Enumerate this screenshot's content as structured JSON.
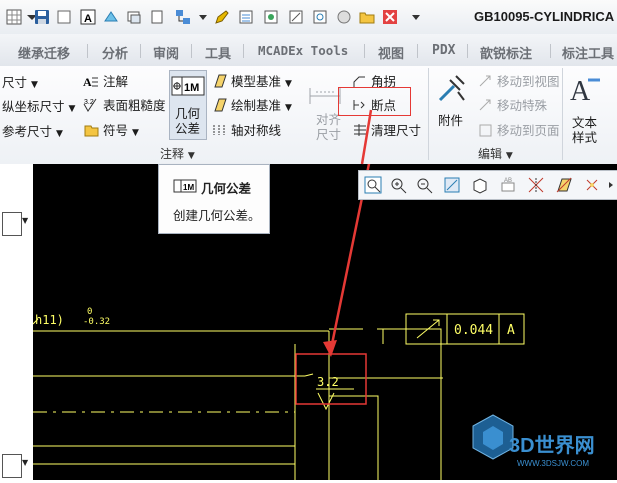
{
  "window": {
    "title": "GB10095-CYLINDRICA"
  },
  "tabs": [
    "继承迁移",
    "分析",
    "审阅",
    "工具",
    "MCADEx Tools",
    "视图",
    "PDX",
    "歆锐标注",
    "标注工具"
  ],
  "ribbon": {
    "left_col": [
      {
        "label": "尺寸",
        "icon": "dimension-icon"
      },
      {
        "label": "纵坐标尺寸",
        "icon": "ordinate-dimension-icon"
      },
      {
        "label": "参考尺寸",
        "icon": "reference-dimension-icon"
      }
    ],
    "col2": [
      {
        "label": "注解",
        "icon": "note-icon"
      },
      {
        "label": "表面粗糙度",
        "icon": "surface-finish-icon"
      },
      {
        "label": "符号",
        "icon": "symbol-icon"
      }
    ],
    "gtol": {
      "label1": "几何",
      "label2": "公差",
      "icon_text": "1M"
    },
    "col4": [
      {
        "label": "模型基准",
        "icon": "model-datum-icon"
      },
      {
        "label": "绘制基准",
        "icon": "draft-datum-icon"
      },
      {
        "label": "轴对称线",
        "icon": "symmetry-line-icon"
      }
    ],
    "align": {
      "label1": "对齐",
      "label2": "尺寸"
    },
    "col6": [
      {
        "label": "角拐",
        "icon": "jog-icon"
      },
      {
        "label": "断点",
        "icon": "break-icon"
      },
      {
        "label": "清理尺寸",
        "icon": "cleanup-dimensions-icon"
      }
    ],
    "attach": {
      "label": "附件"
    },
    "col8": [
      {
        "label": "移动到视图"
      },
      {
        "label": "移动特殊"
      },
      {
        "label": "移动到页面"
      }
    ],
    "textstyle": {
      "label1": "文本",
      "label2": "样式"
    },
    "group_annotate": "注释",
    "group_edit": "编辑"
  },
  "tooltip": {
    "title": "几何公差",
    "desc": "创建几何公差。",
    "icon_text": "1M"
  },
  "drawing": {
    "dim_text": "3.2",
    "tol_value": "0.044",
    "datum": "A",
    "fit_text": "h11)",
    "fit_upper": "0",
    "fit_lower": "-0.32"
  },
  "watermark": {
    "text": "3D世界网",
    "sub": "WWW.3DSJW.COM"
  },
  "colors": {
    "canvas": "#000000",
    "geometry": "#ffff66",
    "highlight": "#e53935"
  }
}
